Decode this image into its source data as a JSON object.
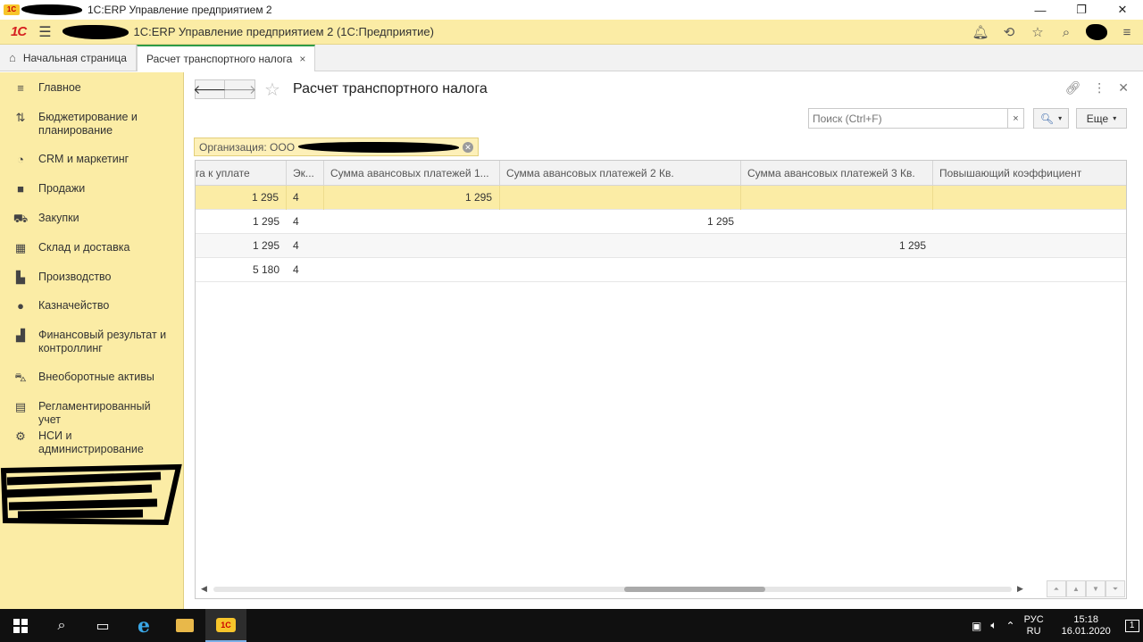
{
  "window": {
    "title": "1C:ERP Управление предприятием 2",
    "controls": [
      "—",
      "❐",
      "✕"
    ]
  },
  "appbar": {
    "logo": "1С",
    "title": "1С:ERP Управление предприятием 2  (1С:Предприятие)"
  },
  "tabs": [
    {
      "label": "Начальная страница"
    },
    {
      "label": "Расчет транспортного налога",
      "close": "×"
    }
  ],
  "sidebar": {
    "items": [
      {
        "label": "Главное",
        "icon": "menu-icon"
      },
      {
        "label": "Бюджетирование и планирование",
        "icon": "budget-icon"
      },
      {
        "label": "CRM и маркетинг",
        "icon": "pie-chart-icon"
      },
      {
        "label": "Продажи",
        "icon": "bag-icon"
      },
      {
        "label": "Закупки",
        "icon": "cart-icon"
      },
      {
        "label": "Склад и доставка",
        "icon": "warehouse-icon"
      },
      {
        "label": "Производство",
        "icon": "factory-icon"
      },
      {
        "label": "Казначейство",
        "icon": "ruble-coin-icon"
      },
      {
        "label": "Финансовый результат и контроллинг",
        "icon": "bar-chart-icon"
      },
      {
        "label": "Внеоборотные активы",
        "icon": "truck-icon"
      },
      {
        "label": "Регламентированный учет",
        "icon": "calculator-icon"
      },
      {
        "label": "НСИ и администрирование",
        "icon": "gear-icon"
      }
    ]
  },
  "form": {
    "title": "Расчет транспортного налога",
    "search_placeholder": "Поиск (Ctrl+F)",
    "search_clear": "×",
    "more_label": "Еще",
    "filter_label": "Организация: ООО "
  },
  "table": {
    "columns": [
      "га к уплате",
      "Эк...",
      "Сумма авансовых платежей 1...",
      "Сумма авансовых платежей 2 Кв.",
      "Сумма авансовых платежей 3 Кв.",
      "Повышающий коэффициент"
    ],
    "rows": [
      {
        "c0": "1 295",
        "c1": "4",
        "c2": "1 295",
        "c3": "",
        "c4": "",
        "c5": ""
      },
      {
        "c0": "1 295",
        "c1": "4",
        "c2": "",
        "c3": "1 295",
        "c4": "",
        "c5": ""
      },
      {
        "c0": "1 295",
        "c1": "4",
        "c2": "",
        "c3": "",
        "c4": "1 295",
        "c5": ""
      },
      {
        "c0": "5 180",
        "c1": "4",
        "c2": "",
        "c3": "",
        "c4": "",
        "c5": ""
      }
    ],
    "selected_row": 0
  },
  "taskbar": {
    "lang_top": "РУС",
    "lang_bottom": "RU",
    "time": "15:18",
    "date": "16.01.2020",
    "notifications": "1"
  },
  "colors": {
    "accent_yellow": "#fbeca5",
    "active_tab_border": "#2e9b47",
    "brand_red": "#d62020"
  }
}
